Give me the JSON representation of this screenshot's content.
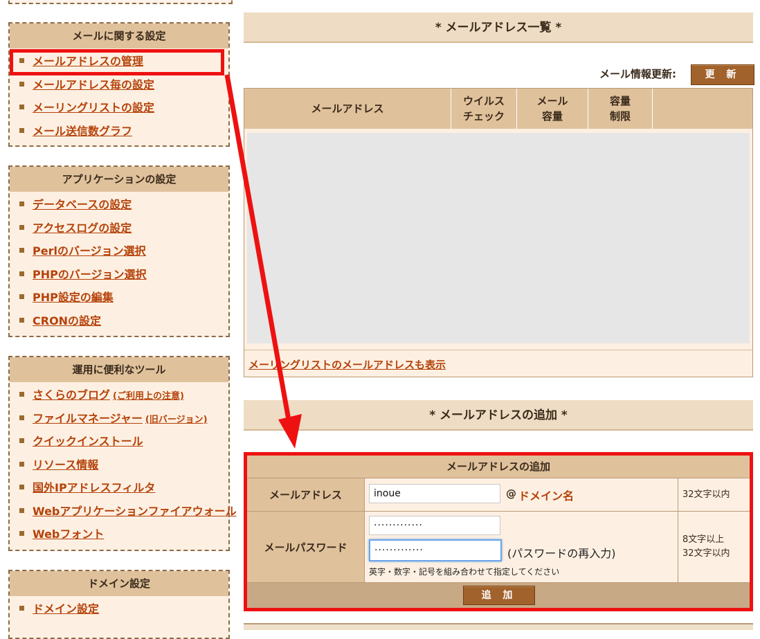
{
  "sidebar": {
    "mail": {
      "title": "メールに関する設定",
      "items": [
        "メールアドレスの管理",
        "メールアドレス毎の設定",
        "メーリングリストの設定",
        "メール送信数グラフ"
      ]
    },
    "apps": {
      "title": "アプリケーションの設定",
      "items": [
        "データベースの設定",
        "アクセスログの設定",
        "Perlのバージョン選択",
        "PHPのバージョン選択",
        "PHP設定の編集",
        "CRONの設定"
      ]
    },
    "tools": {
      "title": "運用に便利なツール",
      "items": [
        {
          "label": "さくらのブログ",
          "sub": "(ご利用上の注意)"
        },
        {
          "label": "ファイルマネージャー",
          "sub": "(旧バージョン)"
        },
        {
          "label": "クイックインストール",
          "sub": ""
        },
        {
          "label": "リソース情報",
          "sub": ""
        },
        {
          "label": "国外IPアドレスフィルタ",
          "sub": ""
        },
        {
          "label": "Webアプリケーションファイアウォール",
          "sub": ""
        },
        {
          "label": "Webフォント",
          "sub": ""
        }
      ]
    },
    "domain": {
      "title": "ドメイン設定",
      "items": [
        "ドメイン設定"
      ]
    }
  },
  "list": {
    "heading": "* メールアドレス一覧 *",
    "refresh_label": "メール情報更新:",
    "refresh_button": "更 新",
    "columns": [
      "メールアドレス",
      "ウイルス\nチェック",
      "メール\n容量",
      "容量\n制限",
      ""
    ],
    "footer_link": "メーリングリストのメールアドレスも表示"
  },
  "add": {
    "heading": "* メールアドレスの追加 *",
    "form_title": "メールアドレスの追加",
    "address_label": "メールアドレス",
    "address_value": "inoue",
    "domain_prefix": "@",
    "domain_link": "ドメイン名",
    "address_note": "32文字以内",
    "password_label": "メールパスワード",
    "password_value": "·············",
    "password_confirm_value": "·············",
    "password_confirm_hint": "(パスワードの再入力)",
    "password_hint": "英字・数字・記号を組み合わせて指定してください",
    "password_note_1": "8文字以上",
    "password_note_2": "32文字以内",
    "submit_button": "追 加"
  },
  "colors": {
    "highlight": "#ee1111",
    "header_bg": "#dfc19c",
    "panel_bg": "#fdf0e2",
    "link": "#b5420a",
    "button": "#a1622c"
  }
}
